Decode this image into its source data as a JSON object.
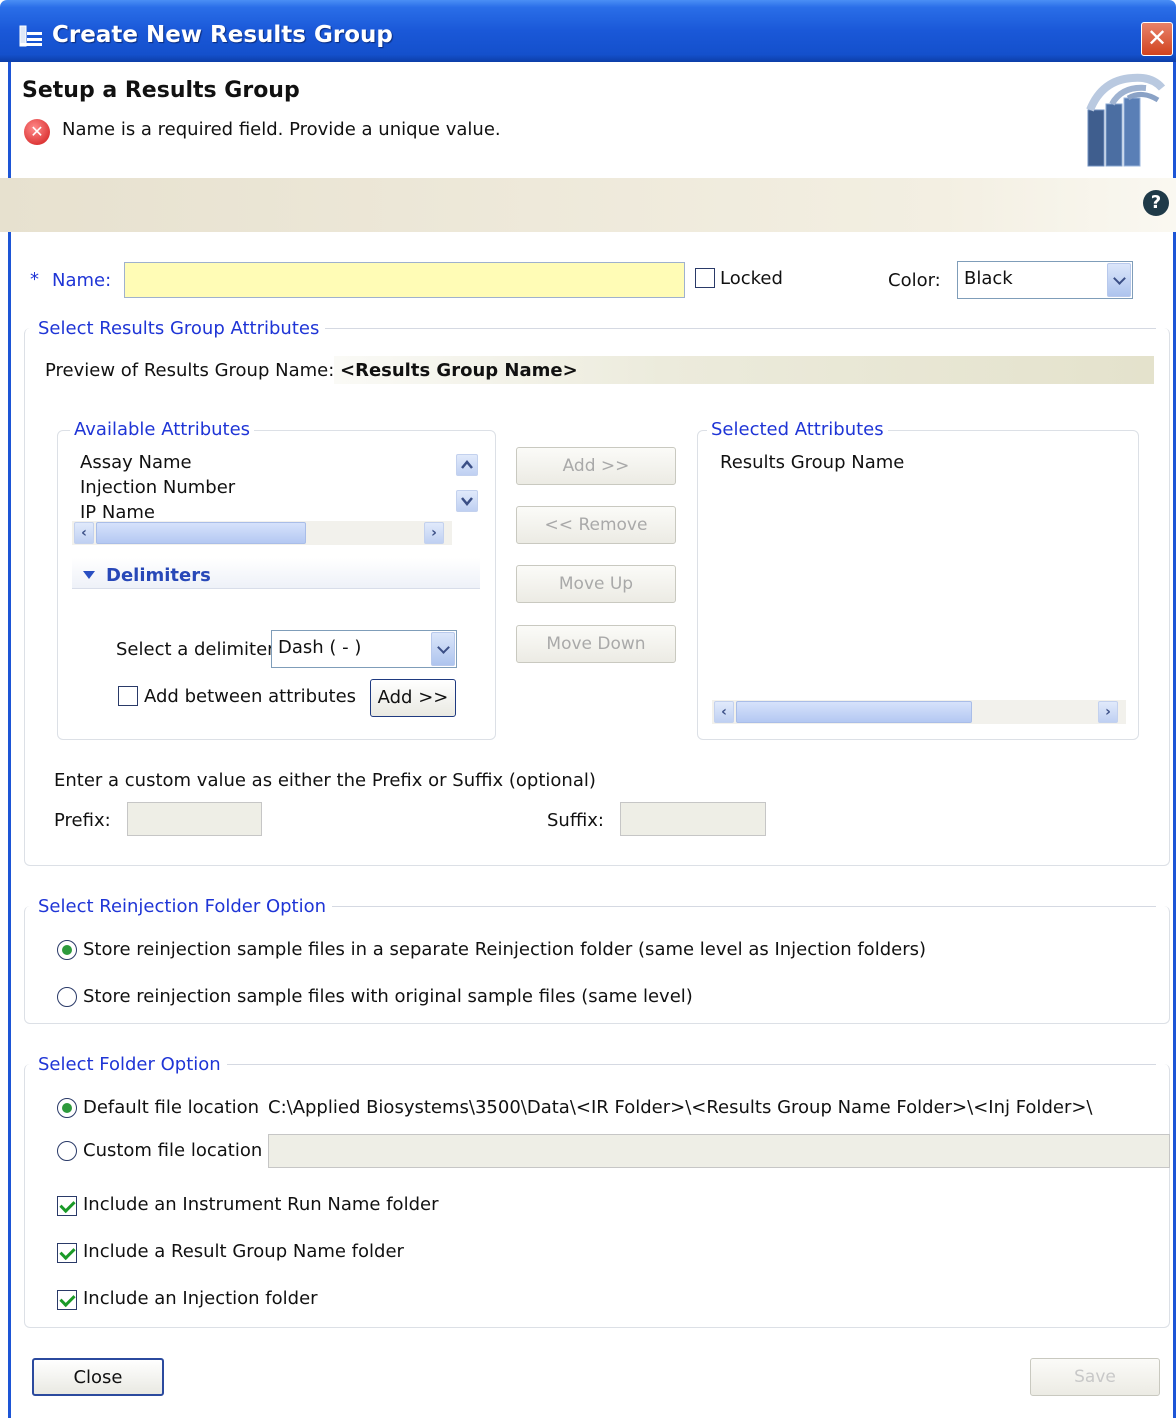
{
  "window": {
    "title": "Create New Results Group",
    "close_symbol": "✕"
  },
  "header": {
    "title": "Setup a Results Group",
    "error_message": "Name is a required field. Provide a unique value.",
    "help_symbol": "?"
  },
  "name_row": {
    "asterisk": "*",
    "label": "Name:",
    "value": "",
    "locked_label": "Locked",
    "locked_checked": false,
    "color_label": "Color:",
    "color_value": "Black"
  },
  "attributes_group": {
    "title": "Select Results Group Attributes",
    "preview_label": "Preview of Results Group Name:",
    "preview_value": "<Results Group Name>",
    "available": {
      "title": "Available Attributes",
      "items": [
        "Assay Name",
        "Injection Number",
        "IP Name"
      ]
    },
    "buttons": {
      "add": "Add >>",
      "remove": "<< Remove",
      "move_up": "Move Up",
      "move_down": "Move Down"
    },
    "selected": {
      "title": "Selected Attributes",
      "items": [
        "Results Group Name"
      ]
    },
    "delimiters": {
      "title": "Delimiters",
      "select_label": "Select a delimiter",
      "select_value": "Dash ( - )",
      "add_between_label": "Add between attributes",
      "add_between_checked": false,
      "add_button": "Add >>"
    },
    "custom_label": "Enter a custom value as either the Prefix or Suffix (optional)",
    "prefix_label": "Prefix:",
    "prefix_value": "",
    "suffix_label": "Suffix:",
    "suffix_value": ""
  },
  "reinjection_group": {
    "title": "Select Reinjection Folder Option",
    "options": [
      {
        "label": "Store reinjection sample files in a separate Reinjection folder (same level as Injection folders)",
        "selected": true
      },
      {
        "label": "Store reinjection sample files with original sample files (same level)",
        "selected": false
      }
    ]
  },
  "folder_group": {
    "title": "Select Folder Option",
    "default_label": "Default file location",
    "default_path": "C:\\Applied Biosystems\\3500\\Data\\<IR Folder>\\<Results Group Name Folder>\\<Inj Folder>\\",
    "default_selected": true,
    "custom_label": "Custom file location",
    "custom_selected": false,
    "custom_value": "",
    "checkboxes": [
      {
        "label": "Include an Instrument Run Name folder",
        "checked": true
      },
      {
        "label": "Include a Result Group Name folder",
        "checked": true
      },
      {
        "label": "Include an Injection folder",
        "checked": true
      }
    ]
  },
  "footer": {
    "close": "Close",
    "save": "Save"
  },
  "colors": {
    "title_bar": "#1a58d8",
    "accent_text": "#1f35d6",
    "name_field_bg": "#fffcb6",
    "error_red": "#d01818"
  }
}
